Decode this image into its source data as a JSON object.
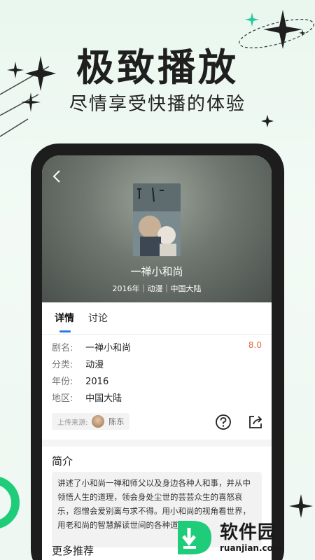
{
  "promo": {
    "title": "极致播放",
    "subtitle": "尽情享受快播的体验"
  },
  "detail": {
    "hero": {
      "title": "一禅小和尚",
      "meta": "2016年｜动漫｜中国大陆"
    },
    "tabs": [
      {
        "label": "详情",
        "active": true
      },
      {
        "label": "讨论",
        "active": false
      }
    ],
    "info": [
      {
        "key": "剧名:",
        "value": "一禅小和尚"
      },
      {
        "key": "分类:",
        "value": "动漫"
      },
      {
        "key": "年份:",
        "value": "2016"
      },
      {
        "key": "地区:",
        "value": "中国大陆"
      }
    ],
    "rating": "8.0",
    "uploader_label": "上传来源:",
    "uploader_name": "陈东",
    "synopsis_title": "简介",
    "synopsis": "讲述了小和尚一禅和师父以及身边各种人和事，并从中领悟人生的道理，领会身处尘世的芸芸众生的喜怒哀乐，怨憎会爱别离与求不得。用小和尚的视角看世界，用老和尚的智慧解读世间的各种道理。",
    "more_title": "更多推荐"
  },
  "watermark": {
    "cn": "软件园",
    "url": "ruanjian.com"
  },
  "colors": {
    "accent": "#2b7ae5",
    "rating": "#e26a3d",
    "green": "#1fcc7a"
  }
}
